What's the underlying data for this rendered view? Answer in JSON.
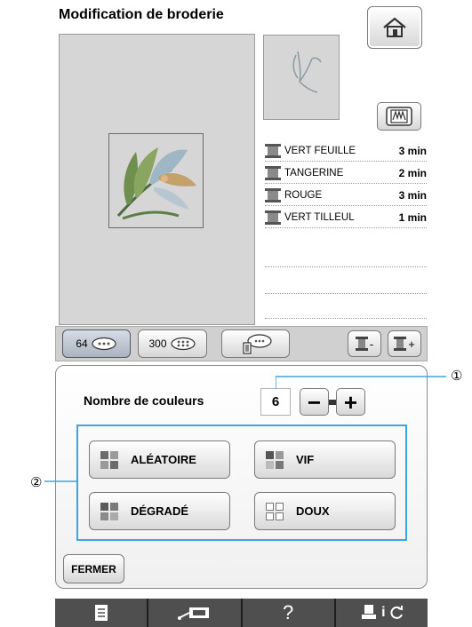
{
  "screen": {
    "title": "Modification de broderie"
  },
  "thread_list": [
    {
      "name": "VERT FEUILLE",
      "time": "3 min"
    },
    {
      "name": "TANGERINE",
      "time": "2 min"
    },
    {
      "name": "ROUGE",
      "time": "3 min"
    },
    {
      "name": "VERT TILLEUL",
      "time": "1 min"
    }
  ],
  "toolbar": {
    "btn_64": "64",
    "btn_300": "300",
    "thread_minus": "-",
    "thread_plus": "+"
  },
  "panel": {
    "label": "Nombre de couleurs",
    "value": "6",
    "minus": "−",
    "plus": "+",
    "options": {
      "random": "ALÉATOIRE",
      "vivid": "VIF",
      "gradient": "DÉGRADÉ",
      "soft": "DOUX"
    },
    "close": "FERMER"
  },
  "bottom_bar": {
    "help": "?"
  },
  "callouts": {
    "one": "①",
    "two": "②"
  },
  "colors": {
    "selection_outline": "#3aa6dd",
    "bottom_bar": "#4f4f4f",
    "canvas": "#d6d6d6"
  },
  "icons": [
    "home-icon",
    "stitch-view-icon",
    "thread-spool-icon",
    "thread-unit-icon",
    "page-icon",
    "machine-icon",
    "refresh-icon"
  ]
}
